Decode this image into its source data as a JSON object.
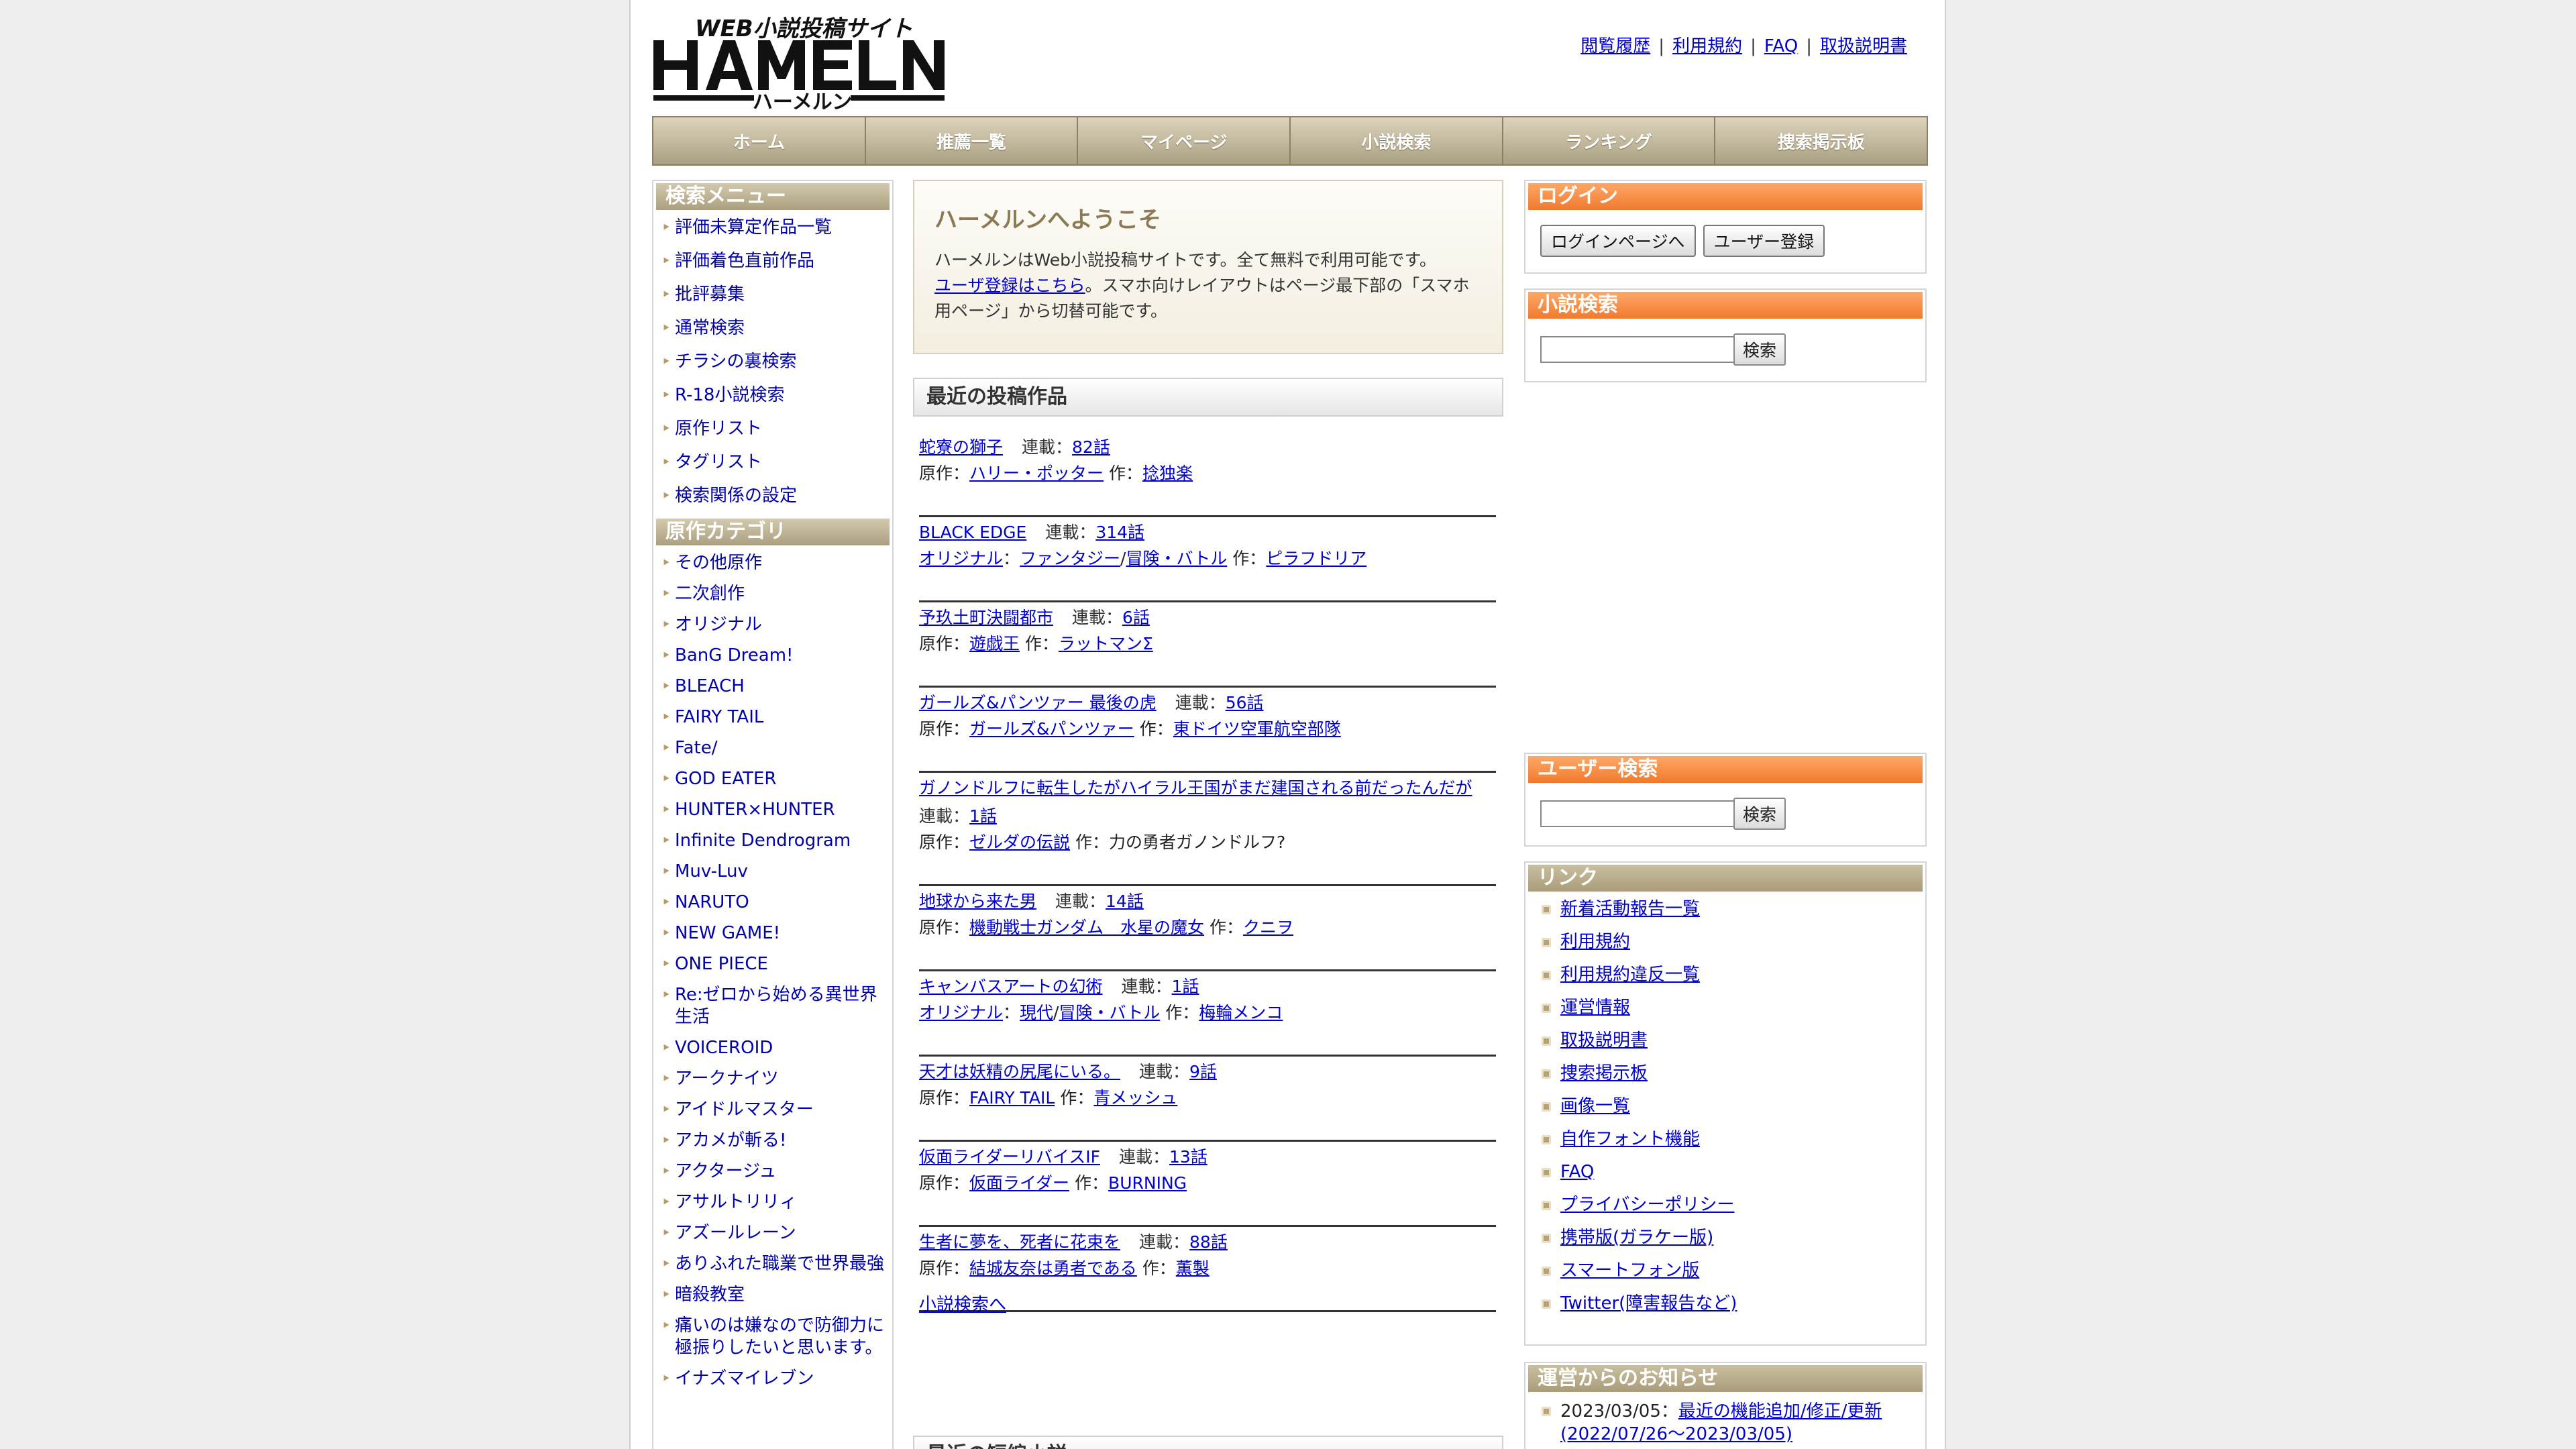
{
  "header": {
    "logo_tagline": "WEB小説投稿サイト",
    "logo_text": "HAMELN",
    "logo_kana": "ハーメルン",
    "top_links": [
      "閲覧履歴",
      "利用規約",
      "FAQ",
      "取扱説明書"
    ]
  },
  "nav": [
    "ホーム",
    "推薦一覧",
    "マイページ",
    "小説検索",
    "ランキング",
    "捜索掲示板"
  ],
  "sidebar": {
    "search_menu_title": "検索メニュー",
    "search_menu": [
      "評価未算定作品一覧",
      "評価着色直前作品",
      "批評募集",
      "通常検索",
      "チラシの裏検索",
      "R-18小説検索",
      "原作リスト",
      "タグリスト",
      "検索関係の設定"
    ],
    "category_title": "原作カテゴリ",
    "categories": [
      "その他原作",
      "二次創作",
      "オリジナル",
      "BanG Dream!",
      "BLEACH",
      "FAIRY TAIL",
      "Fate/",
      "GOD EATER",
      "HUNTER×HUNTER",
      "Infinite Dendrogram",
      "Muv-Luv",
      "NARUTO",
      "NEW GAME!",
      "ONE PIECE",
      "Re:ゼロから始める異世界生活",
      "VOICEROID",
      "アークナイツ",
      "アイドルマスター",
      "アカメが斬る!",
      "アクタージュ",
      "アサルトリリィ",
      "アズールレーン",
      "ありふれた職業で世界最強",
      "暗殺教室",
      "痛いのは嫌なので防御力に極振りしたいと思います。",
      "イナズマイレブン"
    ]
  },
  "welcome": {
    "title": "ハーメルンへようこそ",
    "line1": "ハーメルンはWeb小説投稿サイトです。全て無料で利用可能です。",
    "register_link": "ユーザ登録はこちら",
    "line2": "。スマホ向けレイアウトはページ最下部の「スマホ用ページ」から切替可能です。"
  },
  "recent": {
    "title": "最近の投稿作品",
    "works": [
      {
        "title": "蛇寮の獅子",
        "serial": "連載：",
        "episodes": "82話",
        "source_label": "原作：",
        "source": [
          "ハリー・ポッター"
        ],
        "author_label": "作：",
        "author": "捻独楽",
        "author_link": true
      },
      {
        "title": "BLACK EDGE",
        "serial": "連載：",
        "episodes": "314話",
        "source_label": "",
        "source": [
          "オリジナル",
          "ファンタジー",
          "冒険・バトル"
        ],
        "author_label": "作：",
        "author": "ピラフドリア",
        "author_link": true
      },
      {
        "title": "予玖土町決闘都市",
        "serial": "連載：",
        "episodes": "6話",
        "source_label": "原作：",
        "source": [
          "遊戯王"
        ],
        "author_label": "作：",
        "author": "ラットマンΣ",
        "author_link": true
      },
      {
        "title": "ガールズ&パンツァー 最後の虎",
        "serial": "連載：",
        "episodes": "56話",
        "source_label": "原作：",
        "source": [
          "ガールズ&パンツァー"
        ],
        "author_label": "作：",
        "author": "東ドイツ空軍航空部隊",
        "author_link": true
      },
      {
        "title": "ガノンドルフに転生したがハイラル王国がまだ建国される前だったんだが",
        "serial": "連載：",
        "episodes": "1話",
        "source_label": "原作：",
        "source": [
          "ゼルダの伝説"
        ],
        "author_label": "作：",
        "author": "力の勇者ガノンドルフ?",
        "author_link": false
      },
      {
        "title": "地球から来た男",
        "serial": "連載：",
        "episodes": "14話",
        "source_label": "原作：",
        "source": [
          "機動戦士ガンダム　水星の魔女"
        ],
        "author_label": "作：",
        "author": "クニヲ",
        "author_link": true
      },
      {
        "title": "キャンバスアートの幻術",
        "serial": "連載：",
        "episodes": "1話",
        "source_label": "",
        "source": [
          "オリジナル",
          "現代",
          "冒険・バトル"
        ],
        "author_label": "作：",
        "author": "梅輪メンコ",
        "author_link": true
      },
      {
        "title": "天才は妖精の尻尾にいる。",
        "serial": "連載：",
        "episodes": "9話",
        "source_label": "原作：",
        "source": [
          "FAIRY TAIL"
        ],
        "author_label": "作：",
        "author": "青メッシュ",
        "author_link": true
      },
      {
        "title": "仮面ライダーリバイスIF",
        "serial": "連載：",
        "episodes": "13話",
        "source_label": "原作：",
        "source": [
          "仮面ライダー"
        ],
        "author_label": "作：",
        "author": "BURNING",
        "author_link": true
      },
      {
        "title": "生者に夢を、死者に花束を",
        "serial": "連載：",
        "episodes": "88話",
        "source_label": "原作：",
        "source": [
          "結城友奈は勇者である"
        ],
        "author_label": "作：",
        "author": "薫製",
        "author_link": true
      }
    ],
    "search_link": "小説検索へ"
  },
  "recent2_title": "最近の短編小説",
  "right": {
    "login_title": "ログイン",
    "login_button": "ログインページへ",
    "register_button": "ユーザー登録",
    "novel_search_title": "小説検索",
    "search_button": "検索",
    "user_search_title": "ユーザー検索",
    "links_title": "リンク",
    "links": [
      "新着活動報告一覧",
      "利用規約",
      "利用規約違反一覧",
      "運営情報",
      "取扱説明書",
      "捜索掲示板",
      "画像一覧",
      "自作フォント機能",
      "FAQ",
      "プライバシーポリシー",
      "携帯版(ガラケー版)",
      "スマートフォン版",
      "Twitter(障害報告など)"
    ],
    "news_title": "運営からのお知らせ",
    "news": [
      {
        "date": "2023/03/05：",
        "text": "最近の機能追加/修正/更新(2022/07/26～2023/03/05)"
      }
    ]
  },
  "colors": {
    "accent_orange": "#f07a2e",
    "accent_tan": "#a99c7a",
    "link": "#0000cc"
  }
}
